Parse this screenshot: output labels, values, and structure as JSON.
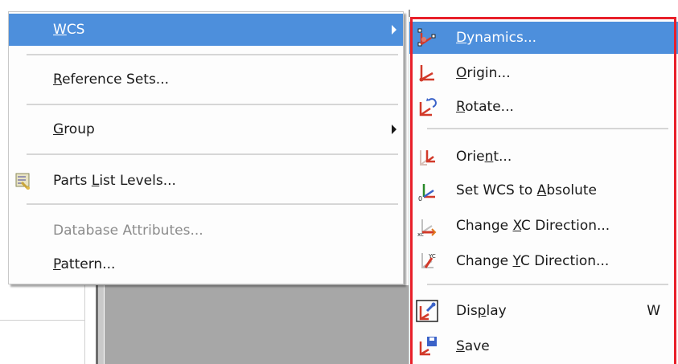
{
  "main_menu": {
    "items": [
      {
        "label": "WCS",
        "mnemonic_index": 0,
        "highlighted": true,
        "has_submenu": true
      },
      {
        "label": "Reference Sets...",
        "mnemonic_index": 0
      },
      {
        "label": "Group",
        "mnemonic_index": 0,
        "has_submenu": true
      },
      {
        "label": "Parts List Levels...",
        "mnemonic_index": 6,
        "icon": "parts-list-icon"
      },
      {
        "label": "Database Attributes...",
        "disabled": true
      },
      {
        "label": "Pattern...",
        "mnemonic_index": 0
      }
    ]
  },
  "wcs_submenu": {
    "items": [
      {
        "label": "Dynamics...",
        "icon": "dynamics-icon",
        "highlighted": true
      },
      {
        "label": "Origin...",
        "icon": "origin-icon"
      },
      {
        "label": "Rotate...",
        "icon": "rotate-icon"
      },
      {
        "label": "Orient...",
        "icon": "orient-icon"
      },
      {
        "label": "Set WCS to Absolute",
        "icon": "absolute-icon"
      },
      {
        "label": "Change XC Direction...",
        "icon": "xc-direction-icon"
      },
      {
        "label": "Change YC Direction...",
        "icon": "yc-direction-icon"
      },
      {
        "label": "Display",
        "icon": "display-icon",
        "shortcut": "W"
      },
      {
        "label": "Save",
        "icon": "save-icon"
      }
    ]
  },
  "colors": {
    "highlight": "#4d8fdc",
    "callout_border": "#e8202a",
    "disabled_text": "#8c8c8c"
  }
}
